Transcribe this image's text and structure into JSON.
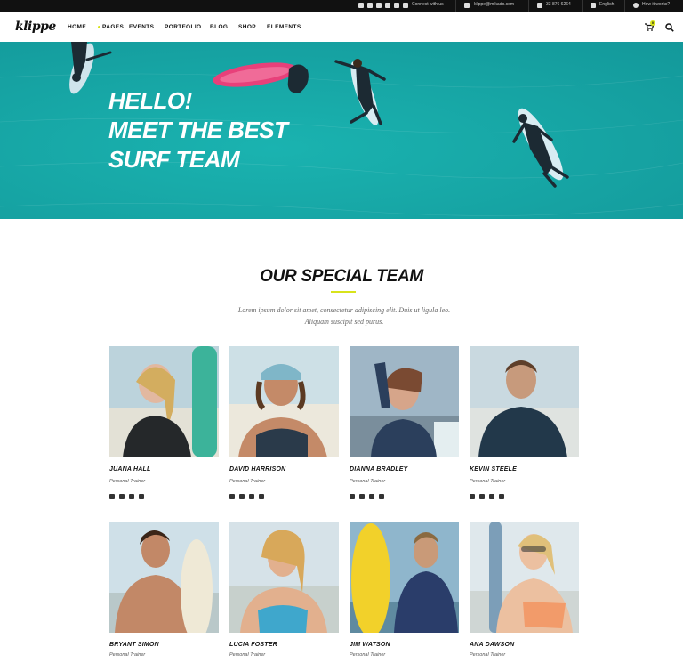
{
  "topbar": {
    "connect": "Connect with us",
    "email": "klippe@mikado.com",
    "phone": "33 876 6264",
    "language": "English",
    "how": "How it works?"
  },
  "header": {
    "logo": "klippe",
    "nav": [
      "HOME",
      "PAGES",
      "EVENTS",
      "PORTFOLIO",
      "BLOG",
      "SHOP",
      "ELEMENTS"
    ],
    "cart_count": "0"
  },
  "hero": {
    "line1": "HELLO!",
    "line2": "MEET THE BEST",
    "line3": "SURF TEAM"
  },
  "team": {
    "title": "OUR SPECIAL TEAM",
    "subtitle_1": "Lorem ipsum dolor sit amet, consectetur adipiscing elit. Duis ut ligula leo.",
    "subtitle_2": "Aliquam suscipit sed purus.",
    "members": [
      {
        "name": "JUANA HALL",
        "role": "Personal Trainer"
      },
      {
        "name": "DAVID HARRISON",
        "role": "Personal Trainer"
      },
      {
        "name": "DIANNA BRADLEY",
        "role": "Personal Trainer"
      },
      {
        "name": "KEVIN STEELE",
        "role": "Personal Trainer"
      },
      {
        "name": "BRYANT SIMON",
        "role": "Personal Trainer"
      },
      {
        "name": "LUCIA FOSTER",
        "role": "Personal Trainer"
      },
      {
        "name": "JIM WATSON",
        "role": "Personal Trainer"
      },
      {
        "name": "ANA DAWSON",
        "role": "Personal Trainer"
      }
    ]
  },
  "colors": {
    "accent": "#d8e31b",
    "hero_sea": "#17a7a6",
    "topbar": "#111111"
  }
}
